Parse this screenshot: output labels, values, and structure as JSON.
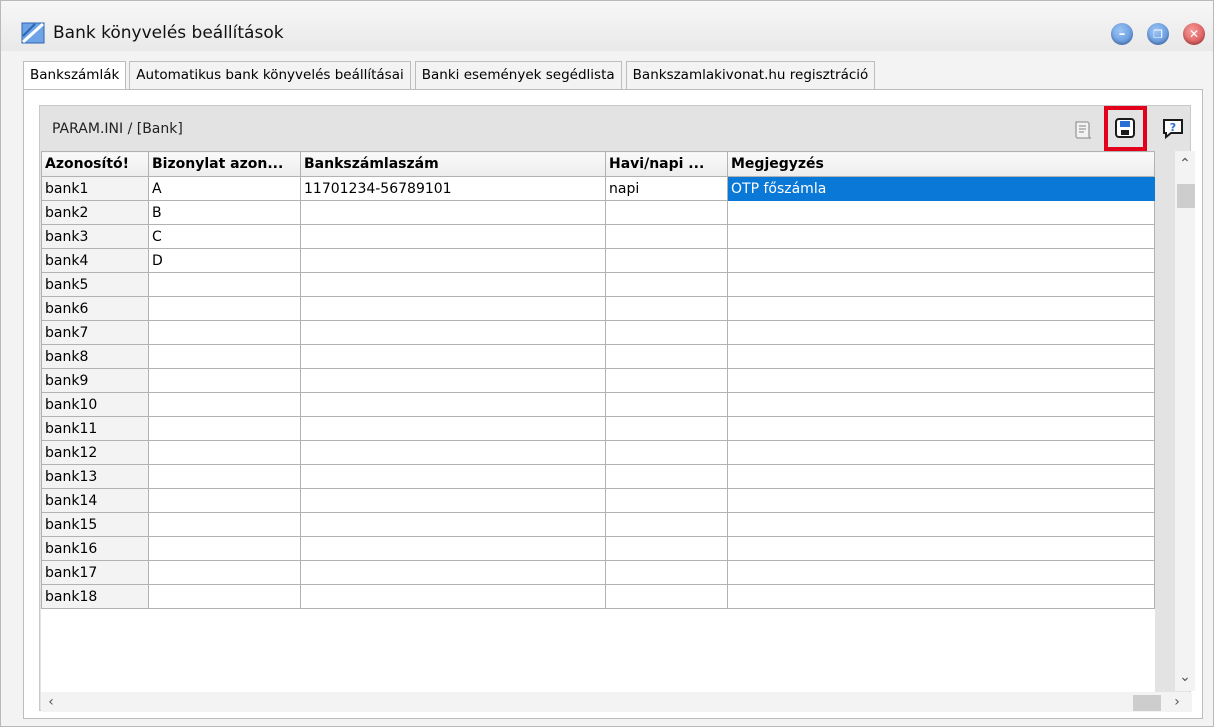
{
  "window": {
    "title": "Bank könyvelés beállítások",
    "minimize_glyph": "–",
    "restore_glyph": "❐",
    "close_glyph": "✕"
  },
  "tabs": [
    {
      "label": "Bankszámlák",
      "active": true
    },
    {
      "label": "Automatikus bank könyvelés beállításai",
      "active": false
    },
    {
      "label": "Banki események segédlista",
      "active": false
    },
    {
      "label": "Bankszamlakivonat.hu regisztráció",
      "active": false
    }
  ],
  "panel": {
    "title": "PARAM.INI / [Bank]",
    "toolbar": {
      "icons": [
        "scroll-icon",
        "save-icon",
        "help-icon"
      ],
      "highlighted": "save-icon",
      "highlight_color": "#e3001b"
    }
  },
  "table": {
    "columns": [
      "Azonosító!",
      "Bizonylat azon...",
      "Bankszámlaszám",
      "Havi/napi ...",
      "Megjegyzés"
    ],
    "rows": [
      [
        "bank1",
        "A",
        "11701234-56789101",
        "napi",
        "OTP főszámla"
      ],
      [
        "bank2",
        "B",
        "",
        "",
        ""
      ],
      [
        "bank3",
        "C",
        "",
        "",
        ""
      ],
      [
        "bank4",
        "D",
        "",
        "",
        ""
      ],
      [
        "bank5",
        "",
        "",
        "",
        ""
      ],
      [
        "bank6",
        "",
        "",
        "",
        ""
      ],
      [
        "bank7",
        "",
        "",
        "",
        ""
      ],
      [
        "bank8",
        "",
        "",
        "",
        ""
      ],
      [
        "bank9",
        "",
        "",
        "",
        ""
      ],
      [
        "bank10",
        "",
        "",
        "",
        ""
      ],
      [
        "bank11",
        "",
        "",
        "",
        ""
      ],
      [
        "bank12",
        "",
        "",
        "",
        ""
      ],
      [
        "bank13",
        "",
        "",
        "",
        ""
      ],
      [
        "bank14",
        "",
        "",
        "",
        ""
      ],
      [
        "bank15",
        "",
        "",
        "",
        ""
      ],
      [
        "bank16",
        "",
        "",
        "",
        ""
      ],
      [
        "bank17",
        "",
        "",
        "",
        ""
      ],
      [
        "bank18",
        "",
        "",
        "",
        ""
      ]
    ],
    "selected_cell": {
      "row": 0,
      "col": 4
    },
    "selection_color": "#0a78d6"
  },
  "scrollbars": {
    "up_glyph": "⌃",
    "down_glyph": "⌄",
    "left_glyph": "‹",
    "right_glyph": "›"
  }
}
